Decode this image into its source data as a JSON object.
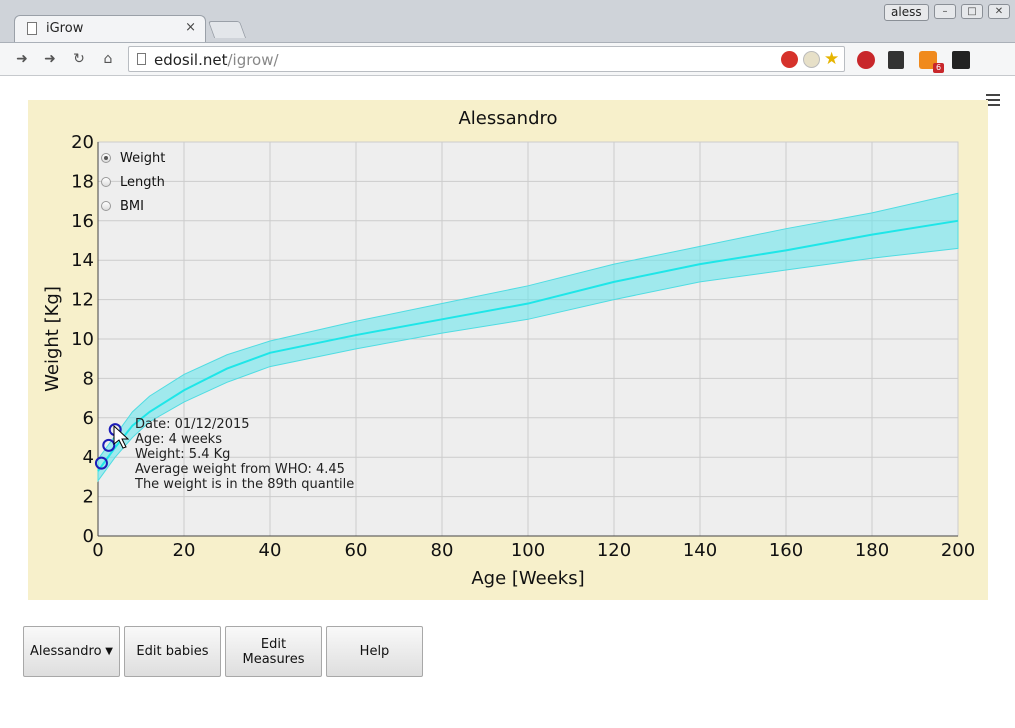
{
  "browser": {
    "tab_title": "iGrow",
    "tab_close": "×",
    "user": "aless",
    "url_host": "edosil.net",
    "url_path": "/igrow/",
    "feed_badge": "6"
  },
  "controls": {
    "baby_select": "Alessandro",
    "edit_babies": "Edit babies",
    "edit_measures_line1": "Edit",
    "edit_measures_line2": "Measures",
    "help": "Help"
  },
  "radio_options": [
    {
      "label": "Weight",
      "checked": true
    },
    {
      "label": "Length",
      "checked": false
    },
    {
      "label": "BMI",
      "checked": false
    }
  ],
  "tooltip": {
    "date": "Date: 01/12/2015",
    "age": "Age: 4 weeks",
    "weight": "Weight: 5.4 Kg",
    "average": "Average weight from WHO: 4.45",
    "quantile": "The weight is in the 89th quantile"
  },
  "chart_data": {
    "type": "line",
    "title": "Alessandro",
    "xlabel": "Age [Weeks]",
    "ylabel": "Weight [Kg]",
    "xlim": [
      0,
      200
    ],
    "ylim": [
      0,
      20
    ],
    "xticks": [
      0,
      20,
      40,
      60,
      80,
      100,
      120,
      140,
      160,
      180,
      200
    ],
    "yticks": [
      0,
      2,
      4,
      6,
      8,
      10,
      12,
      14,
      16,
      18,
      20
    ],
    "grid": true,
    "legend": "none",
    "colors": {
      "median": "#1ee6e8",
      "band": "#60e6ec",
      "points": "#1d1db8",
      "plot_bg": "#eeeeee",
      "panel_bg": "#f7f0cb"
    },
    "series": [
      {
        "name": "",
        "x": [
          0,
          4,
          8,
          12,
          20,
          30,
          40,
          60,
          80,
          100,
          120,
          140,
          160,
          180,
          200
        ],
        "values": [
          3.3,
          4.5,
          5.6,
          6.3,
          7.4,
          8.5,
          9.3,
          10.2,
          11.0,
          11.8,
          12.9,
          13.8,
          14.5,
          15.3,
          16.0
        ]
      },
      {
        "name": "",
        "x": [
          0,
          4,
          8,
          12,
          20,
          30,
          40,
          60,
          80,
          100,
          120,
          140,
          160,
          180,
          200
        ],
        "values": [
          3.9,
          5.1,
          6.3,
          7.1,
          8.2,
          9.2,
          9.9,
          10.9,
          11.8,
          12.7,
          13.8,
          14.7,
          15.6,
          16.4,
          17.4
        ]
      },
      {
        "name": "",
        "x": [
          0,
          4,
          8,
          12,
          20,
          30,
          40,
          60,
          80,
          100,
          120,
          140,
          160,
          180,
          200
        ],
        "values": [
          2.8,
          4.0,
          5.0,
          5.8,
          6.8,
          7.8,
          8.6,
          9.5,
          10.3,
          11.0,
          12.0,
          12.9,
          13.5,
          14.1,
          14.6
        ]
      }
    ],
    "points": [
      {
        "x": 0.8,
        "y": 3.7
      },
      {
        "x": 2.5,
        "y": 4.6
      },
      {
        "x": 4,
        "y": 5.4
      }
    ]
  }
}
